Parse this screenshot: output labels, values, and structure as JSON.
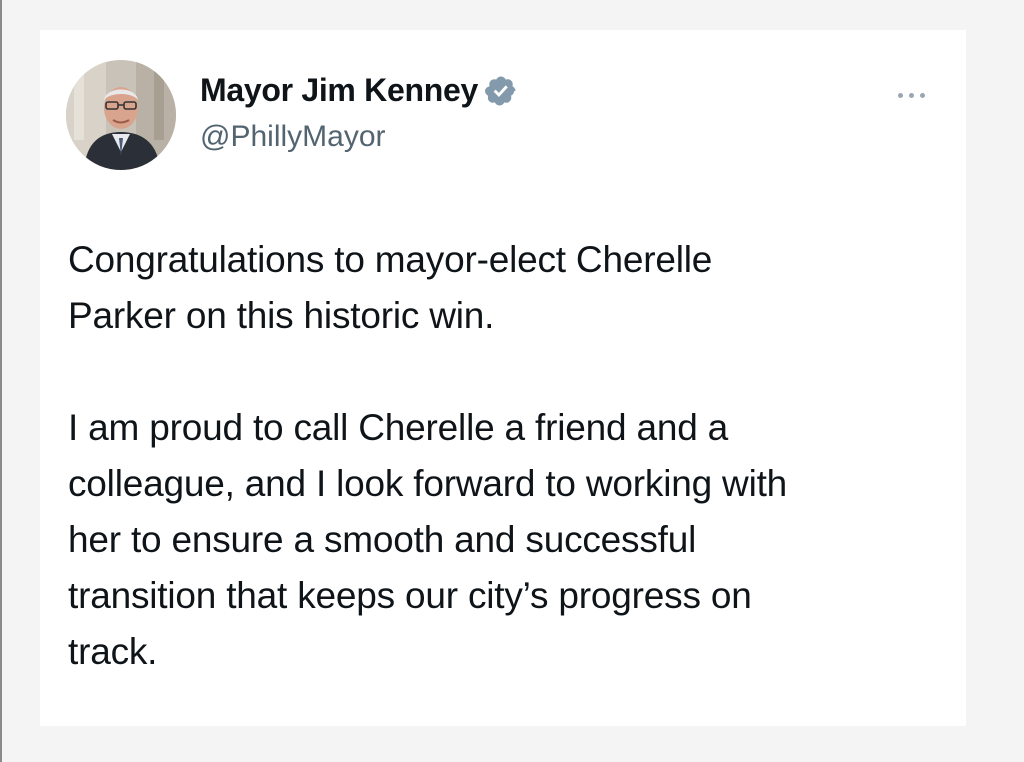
{
  "tweet": {
    "author": {
      "display_name": "Mayor Jim Kenney",
      "handle": "@PhillyMayor",
      "verified": true,
      "verified_icon": "verified-badge-icon",
      "avatar_icon": "profile-photo"
    },
    "more_icon": "more-options-icon",
    "text": {
      "paragraph_1": [
        "Congratulations to mayor-elect Cherelle",
        "Parker on this historic win."
      ],
      "paragraph_2": [
        "I am proud to call Cherelle a friend and a",
        "colleague, and I look forward to working with",
        "her to ensure a smooth and successful",
        "transition that keeps our city’s progress on",
        "track."
      ]
    }
  },
  "colors": {
    "text": "#0f1419",
    "secondary_text": "#536471",
    "verified_badge": "#829aab"
  }
}
